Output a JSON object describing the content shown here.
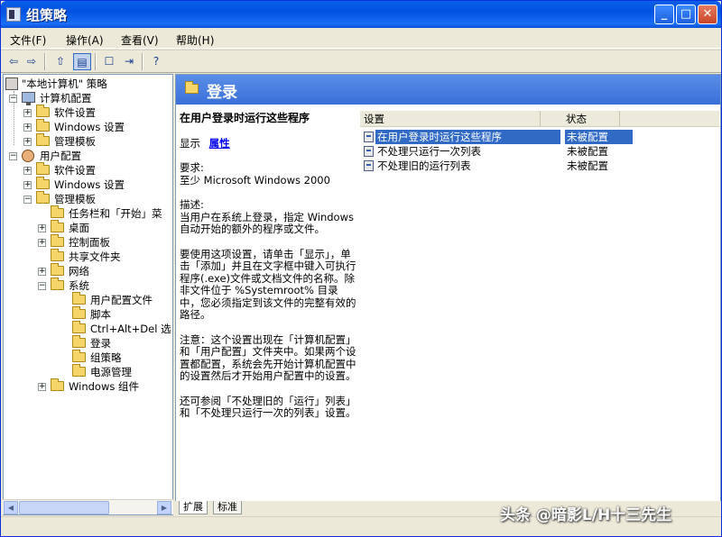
{
  "window": {
    "title": "组策略",
    "buttons": {
      "minimize": "_",
      "maximize": "□",
      "close": "✕"
    }
  },
  "menu": [
    {
      "label": "文件(F)"
    },
    {
      "label": "操作(A)"
    },
    {
      "label": "查看(V)"
    },
    {
      "label": "帮助(H)"
    }
  ],
  "toolbar": {
    "back_icon": "back-arrow-icon",
    "forward_icon": "forward-arrow-icon",
    "glyphs": {
      "back": "⇦",
      "forward": "⇨",
      "up": "⇧",
      "show_tree": "▤",
      "properties": "☐",
      "export": "⇥",
      "help": "?"
    }
  },
  "tree": {
    "root": "\"本地计算机\" 策略",
    "computer_config": "计算机配置",
    "computer_children": [
      "软件设置",
      "Windows 设置",
      "管理模板"
    ],
    "user_config": "用户配置",
    "user_children": [
      "软件设置",
      "Windows 设置",
      "管理模板"
    ],
    "admin_templates_children": [
      "任务栏和「开始」菜",
      "桌面",
      "控制面板",
      "共享文件夹",
      "网络",
      "系统"
    ],
    "system_children": [
      "用户配置文件",
      "脚本",
      "Ctrl+Alt+Del 选",
      "登录",
      "组策略",
      "电源管理"
    ],
    "windows_components": "Windows 组件"
  },
  "right": {
    "header_title": "登录",
    "description": {
      "title": "在用户登录时运行这些程序",
      "display_label": "显示",
      "display_link": "属性",
      "requirement_label": "要求:",
      "requirement_text": "至少 Microsoft Windows 2000",
      "desc_label": "描述:",
      "desc_text": "当用户在系统上登录，指定 Windows 自动开始的额外的程序或文件。",
      "usage_text": "要使用这项设置，请单击「显示」，单击「添加」并且在文字框中键入可执行程序(.exe)文件或文档文件的名称。除非文件位于 %Systemroot% 目录中，您必须指定到该文件的完整有效的路径。",
      "note_text": "注意：这个设置出现在「计算机配置」和「用户配置」文件夹中。如果两个设置都配置，系统会先开始计算机配置中的设置然后才开始用户配置中的设置。",
      "see_also_text": "还可参阅「不处理旧的「运行」列表」和「不处理只运行一次的列表」设置。"
    },
    "columns": {
      "setting": "设置",
      "state": "状态"
    },
    "rows": [
      {
        "name": "在用户登录时运行这些程序",
        "state": "未被配置",
        "selected": true
      },
      {
        "name": "不处理只运行一次列表",
        "state": "未被配置",
        "selected": false
      },
      {
        "name": "不处理旧的运行列表",
        "state": "未被配置",
        "selected": false
      }
    ],
    "tabs": [
      "扩展",
      "标准"
    ]
  },
  "watermark": "头条 @暗影L/H十三先生",
  "colors": {
    "titlebar": "#0053e0",
    "header_blue": "#3a6fd8",
    "selection": "#316ac5",
    "link": "#0000ee"
  }
}
